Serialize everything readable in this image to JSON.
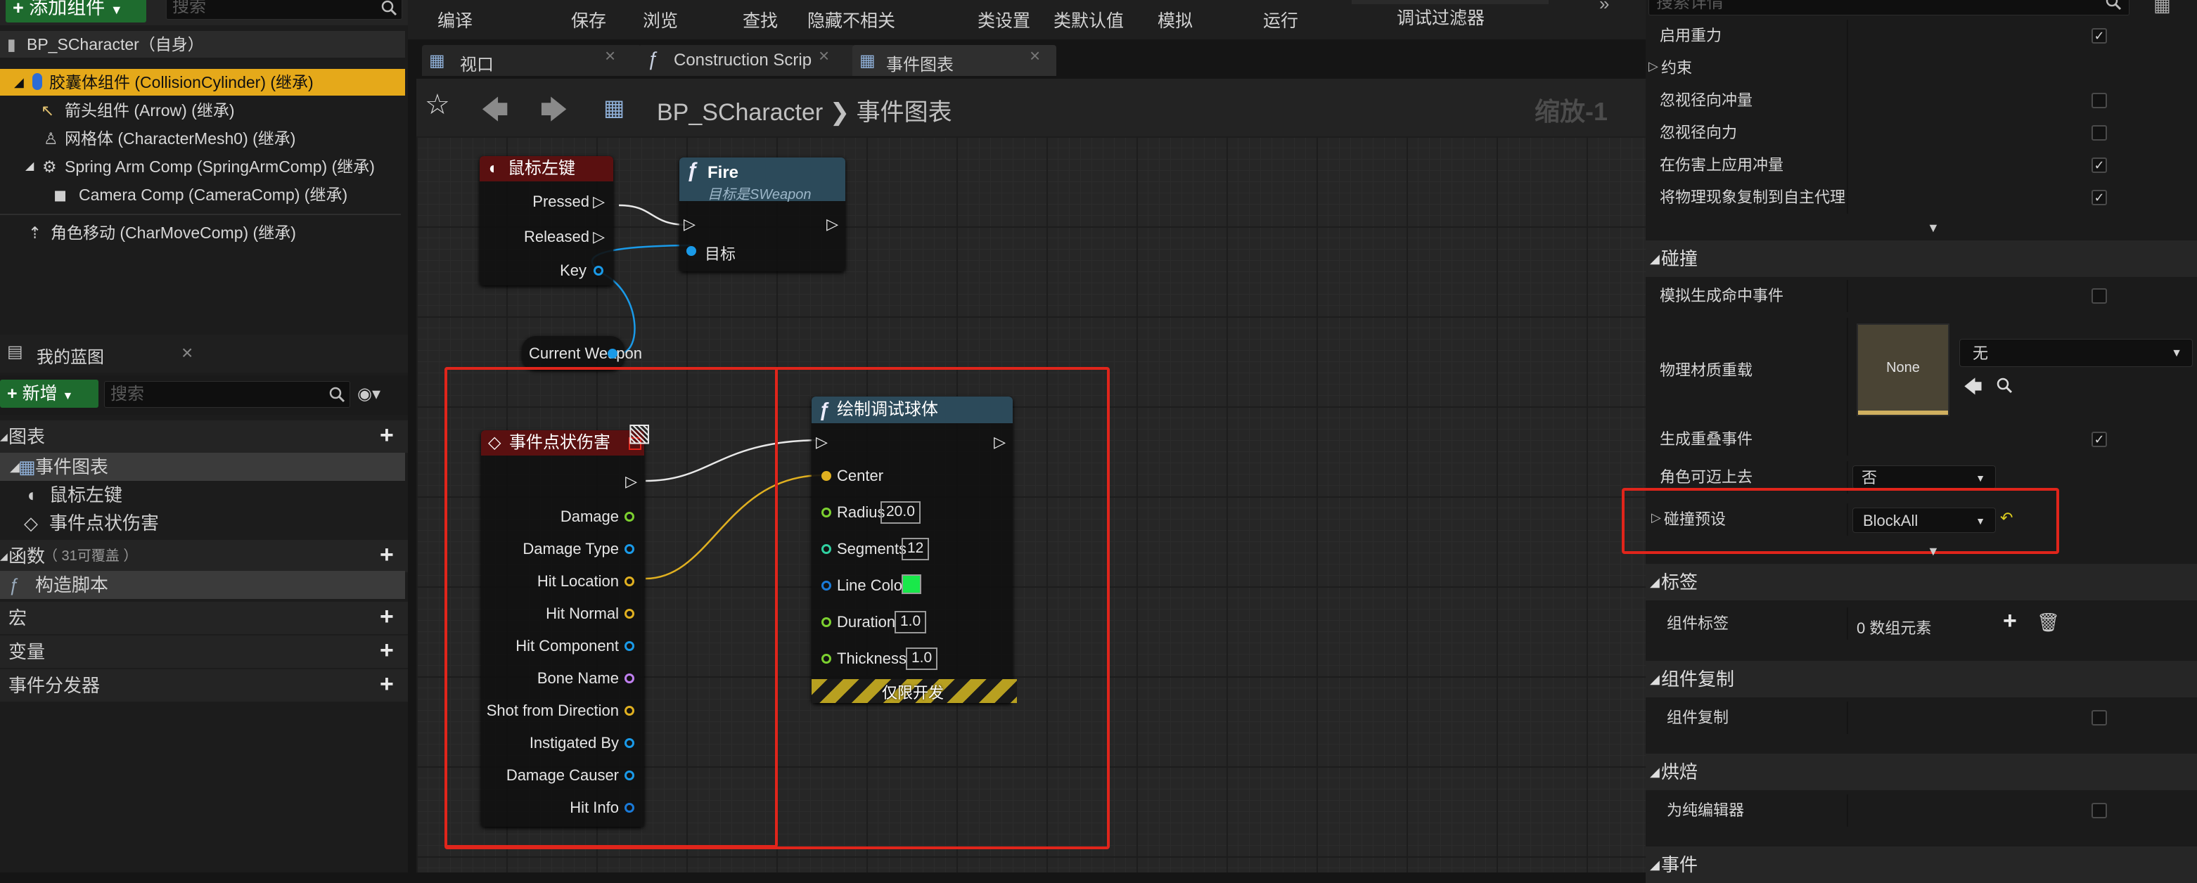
{
  "left": {
    "add_button": "添加组件",
    "search_placeholder": "搜索",
    "component_root": "BP_SCharacter（自身）",
    "components": [
      "胶囊体组件 (CollisionCylinder) (继承)",
      "箭头组件 (Arrow) (继承)",
      "网格体 (CharacterMesh0) (继承)",
      "Spring Arm Comp (SpringArmComp) (继承)",
      "Camera Comp (CameraComp) (继承)",
      "角色移动 (CharMoveComp) (继承)"
    ],
    "my_blueprint": {
      "title": "我的蓝图",
      "new_button": "新增",
      "search_placeholder": "搜索",
      "graphs_label": "图表",
      "event_graph": "事件图表",
      "event_items": [
        "鼠标左键",
        "事件点状伤害"
      ],
      "functions_label": "函数",
      "functions_count": "（ 31可覆盖 ）",
      "function_items": [
        "构造脚本"
      ],
      "macros_label": "宏",
      "variables_label": "变量",
      "dispatchers_label": "事件分发器"
    }
  },
  "toolbar": {
    "items": [
      "编译",
      "保存",
      "浏览",
      "查找",
      "隐藏不相关",
      "类设置",
      "类默认值",
      "模拟",
      "运行"
    ],
    "debug_filter": "调试过滤器"
  },
  "tabs": [
    {
      "label": "视口"
    },
    {
      "label": "Construction Scrip"
    },
    {
      "label": "事件图表"
    }
  ],
  "breadcrumb": {
    "root": "BP_SCharacter",
    "sep": "❯",
    "current": "事件图表",
    "zoom": "缩放-1"
  },
  "nodes": {
    "mouse": {
      "title": "鼠标左键",
      "pins": [
        "Pressed",
        "Released",
        "Key"
      ]
    },
    "fire": {
      "title": "Fire",
      "subtitle": "目标是SWeapon",
      "target": "目标"
    },
    "var": {
      "label": "Current Weapon"
    },
    "damage": {
      "title": "事件点状伤害",
      "pins": [
        "Damage",
        "Damage Type",
        "Hit Location",
        "Hit Normal",
        "Hit Component",
        "Bone Name",
        "Shot from Direction",
        "Instigated By",
        "Damage Causer",
        "Hit Info"
      ]
    },
    "debug": {
      "title": "绘制调试球体",
      "pins": [
        {
          "label": "Center",
          "value": ""
        },
        {
          "label": "Radius",
          "value": "20.0"
        },
        {
          "label": "Segments",
          "value": "12"
        },
        {
          "label": "Line Color",
          "value": ""
        },
        {
          "label": "Duration",
          "value": "1.0"
        },
        {
          "label": "Thickness",
          "value": "1.0"
        }
      ],
      "dev_only": "仅限开发"
    }
  },
  "right": {
    "search_placeholder": "搜索详情",
    "physics_rows": [
      {
        "label": "启用重力",
        "checked": true
      },
      {
        "label": "约束",
        "checked": null
      },
      {
        "label": "忽视径向冲量",
        "checked": false
      },
      {
        "label": "忽视径向力",
        "checked": false
      },
      {
        "label": "在伤害上应用冲量",
        "checked": true
      },
      {
        "label": "将物理现象复制到自主代理",
        "checked": true
      }
    ],
    "collision": {
      "title": "碰撞",
      "sim_hit_label": "模拟生成命中事件",
      "material_label": "物理材质重载",
      "material_thumb": "None",
      "material_value": "无",
      "overlap_label": "生成重叠事件",
      "step_label": "角色可迈上去",
      "step_value": "否",
      "preset_label": "碰撞预设",
      "preset_value": "BlockAll"
    },
    "tags": {
      "title": "标签",
      "label": "组件标签",
      "value": "0 数组元素"
    },
    "replication": {
      "title": "组件复制",
      "label": "组件复制"
    },
    "cooking": {
      "title": "烘焙",
      "label": "为纯编辑器"
    },
    "events": {
      "title": "事件"
    }
  },
  "colors": {
    "selection": "#e5a91a",
    "highlight_box": "#e0251b",
    "line_color_swatch": "#19e84a",
    "exec_wire": "#e8e8e8",
    "vector_pin": "#e0b020",
    "float_pin": "#7cd030",
    "object_pin": "#1a9ae8"
  }
}
